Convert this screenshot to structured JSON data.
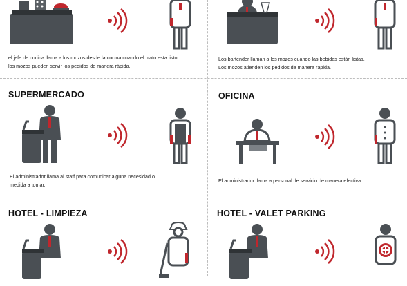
{
  "panels": [
    {
      "id": "restaurante",
      "title": "",
      "description_lines": [
        "el jefe de cocina llama a los mozos desde la cocina  cuando el plato esta listo.",
        "los mozos pueden servir los pedidos de manera rápida."
      ]
    },
    {
      "id": "bar",
      "title": "",
      "description_lines": [
        "Los bartender llaman a los mozos cuando las bebidas  están listas.",
        "Los mozos atienden los pedidos de manera rapida."
      ]
    },
    {
      "id": "supermercado",
      "title": "SUPERMERCADO",
      "description_lines": [
        "El administrador llama al staff para  comunicar alguna necesidad o",
        "medida a tomar."
      ]
    },
    {
      "id": "oficina",
      "title": "OFICINA",
      "description_lines": [
        "El administrador llama a personal de servicio   de manera efectiva."
      ]
    },
    {
      "id": "hotel-limpieza",
      "title": "HOTEL - LIMPIEZA",
      "description_lines": []
    },
    {
      "id": "hotel-valet",
      "title": "HOTEL - VALET PARKING",
      "description_lines": []
    }
  ],
  "icons": {
    "caller": "caller-person-icon",
    "signal": "wireless-signal-icon",
    "receiver": "staff-person-icon"
  },
  "colors": {
    "figure": "#4a4f54",
    "figure_light": "#7c8186",
    "accent": "#c0272d",
    "text": "#222222"
  }
}
